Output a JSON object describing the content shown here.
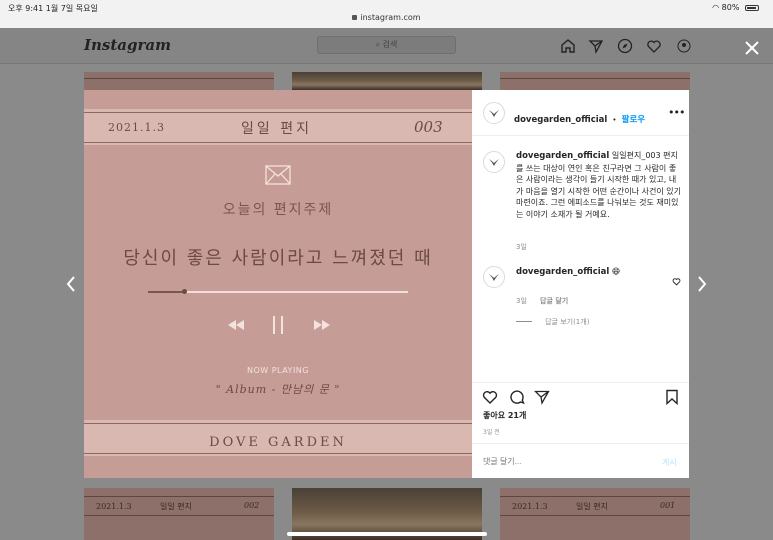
{
  "status_bar": {
    "time_date": "오후 9:41   1월 7일 목요일",
    "url": "instagram.com",
    "battery": "80%"
  },
  "header": {
    "logo": "Instagram",
    "search_placeholder": "검색"
  },
  "post_image": {
    "date": "2021.1.3",
    "title": "일일 편지",
    "number": "003",
    "subject": "오늘의 편지주제",
    "headline": "당신이 좋은 사람이라고 느껴졌던 때",
    "progress": 0.14,
    "now_playing": "NOW PLAYING",
    "album": "\" Album - 만남의 문 \"",
    "brand": "DOVE GARDEN"
  },
  "post": {
    "username": "dovegarden_official",
    "follow_sep": "•",
    "follow": "팔로우",
    "more": "•••",
    "caption_user": "dovegarden_official",
    "caption_text": "일일편지_003 편지를 쓰는 대상이 연인 혹은 친구라면 그 사람이 좋은 사람이라는 생각이 들기 시작한 때가 있고, 내가 마음을 열기 시작한 어떤 순간이나 사건이 있기 마련이죠. 그런 에피소드를 나눠보는 것도 재미있는 이야기 소재가 될 거예요.",
    "caption_time": "3일",
    "comment": {
      "username": "dovegarden_official",
      "text": "😄",
      "time": "3일",
      "reply": "답글 달기",
      "view_replies": "답글 보기(1개)"
    },
    "likes": "좋아요 21개",
    "time_ago": "3일 전",
    "comment_placeholder": "댓글 달기...",
    "post_button": "게시"
  },
  "bg_cards": [
    {
      "date": "2021.1.3",
      "title": "일일 편지",
      "number": "002"
    },
    {
      "date": "2021.1.3",
      "title": "일일 편지",
      "number": "001"
    }
  ]
}
